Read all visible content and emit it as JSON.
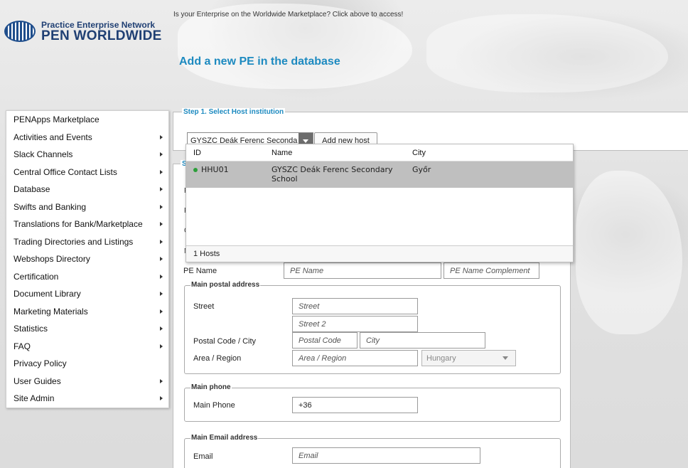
{
  "header": {
    "logo_line1": "Practice Enterprise Network",
    "logo_line2": "PEN WORLDWIDE",
    "notice": "Is your Enterprise on the Worldwide Marketplace? Click above to access!",
    "page_title": "Add a new PE in the database"
  },
  "sidebar": {
    "items": [
      {
        "label": "PENApps Marketplace",
        "submenu": false
      },
      {
        "label": "Activities and Events",
        "submenu": true
      },
      {
        "label": "Slack Channels",
        "submenu": true
      },
      {
        "label": "Central Office Contact Lists",
        "submenu": true
      },
      {
        "label": "Database",
        "submenu": true
      },
      {
        "label": "Swifts and Banking",
        "submenu": true
      },
      {
        "label": "Translations for Bank/Marketplace",
        "submenu": true
      },
      {
        "label": "Trading Directories and Listings",
        "submenu": true
      },
      {
        "label": "Webshops Directory",
        "submenu": true
      },
      {
        "label": "Certification",
        "submenu": true
      },
      {
        "label": "Document Library",
        "submenu": true
      },
      {
        "label": "Marketing Materials",
        "submenu": true
      },
      {
        "label": "Statistics",
        "submenu": true
      },
      {
        "label": "FAQ",
        "submenu": true
      },
      {
        "label": "Privacy Policy",
        "submenu": false
      },
      {
        "label": "User Guides",
        "submenu": true
      },
      {
        "label": "Site Admin",
        "submenu": true
      }
    ]
  },
  "step1": {
    "legend": "Step 1. Select Host institution",
    "host_value_a": "GYSZC Deák Ferenc ",
    "host_value_b": "Seconda",
    "add_host_label": "Add new host"
  },
  "dropdown": {
    "columns": {
      "id": "ID",
      "name": "Name",
      "city": "City"
    },
    "rows": [
      {
        "id": "HHU01",
        "name": "GYSZC Deák Ferenc Secondary School",
        "city": "Győr"
      }
    ],
    "footer": "1 Hosts"
  },
  "step2": {
    "legend_fragment": "S",
    "hidden_letters": [
      "P",
      "F",
      "C",
      "N"
    ]
  },
  "form": {
    "pe_name_label": "PE Name",
    "pe_name_placeholder": "PE Name",
    "pe_name_complement_placeholder": "PE Name Complement",
    "postal": {
      "legend": "Main postal address",
      "street_label": "Street",
      "street_placeholder": "Street",
      "street2_placeholder": "Street 2",
      "postal_city_label": "Postal Code / City",
      "postal_code_placeholder": "Postal Code",
      "city_placeholder": "City",
      "area_label": "Area / Region",
      "area_placeholder": "Area / Region",
      "country_value": "Hungary"
    },
    "phone": {
      "legend": "Main phone",
      "label": "Main Phone",
      "value": "+36"
    },
    "email": {
      "legend": "Main Email address",
      "label": "Email",
      "placeholder": "Email"
    }
  },
  "colors": {
    "accent_blue": "#1d8ac0",
    "logo_blue": "#1f3f73",
    "selected_row": "#bfbfbf",
    "status_dot": "#2c9f3a"
  }
}
